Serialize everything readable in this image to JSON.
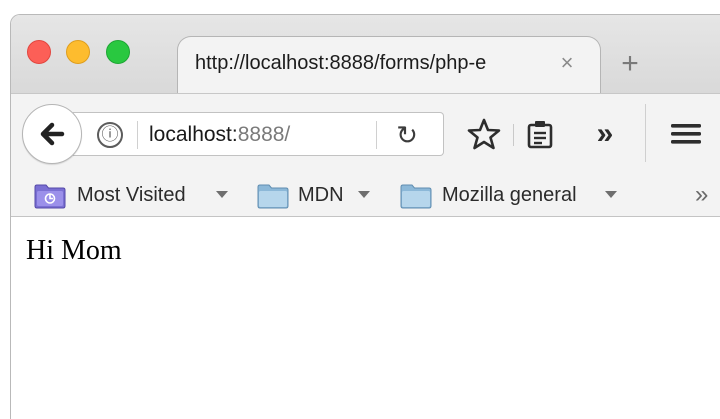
{
  "window": {
    "traffic_lights": {
      "close_color": "#fc5f57",
      "minimize_color": "#fdbc2e",
      "maximize_color": "#29c840"
    }
  },
  "tab": {
    "title": "http://localhost:8888/forms/php-e",
    "close_symbol": "×",
    "new_tab_symbol": "+"
  },
  "toolbar": {
    "back_icon": "back-arrow-icon",
    "info_icon": "ⓘ",
    "url_host": "localhost:",
    "url_port": "8888/",
    "reload_symbol": "↻",
    "overflow_symbol": "»"
  },
  "bookmarks": {
    "items": [
      {
        "label": "Most Visited",
        "icon": "most-visited-folder-icon"
      },
      {
        "label": "MDN",
        "icon": "folder-icon"
      },
      {
        "label": "Mozilla general",
        "icon": "folder-icon"
      }
    ],
    "overflow_symbol": "»"
  },
  "page": {
    "body_text": "Hi Mom"
  }
}
